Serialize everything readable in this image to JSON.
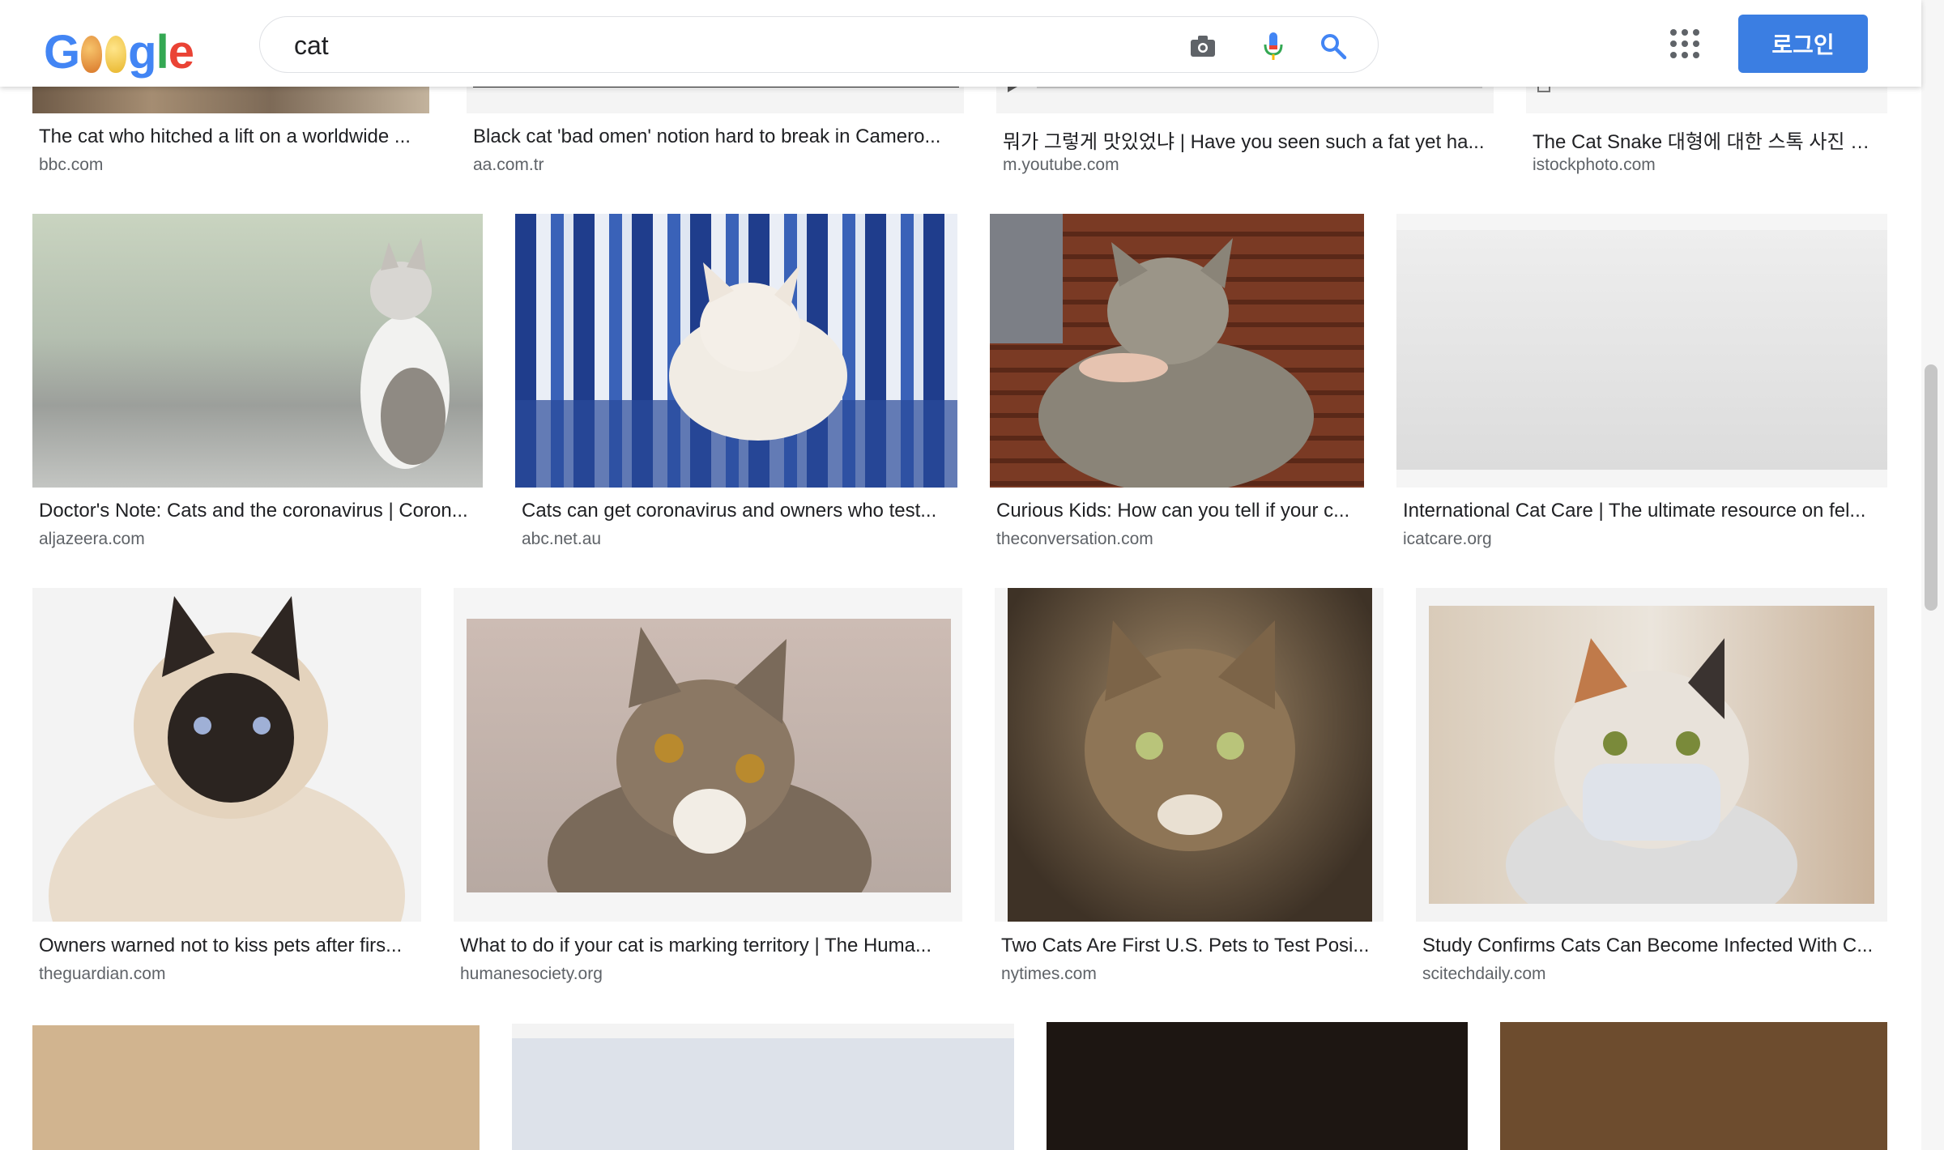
{
  "header": {
    "logo_letters": [
      "G",
      "o",
      "o",
      "g",
      "l",
      "e"
    ],
    "search_value": "cat",
    "login_label": "로그인"
  },
  "results": [
    {
      "title": "The cat who hitched a lift on a worldwide ...",
      "domain": "bbc.com"
    },
    {
      "title": "Black cat 'bad omen' notion hard to break in Camero...",
      "domain": "aa.com.tr"
    },
    {
      "title": "뭐가 그렇게 맛있었냐 | Have you seen such a fat yet ha...",
      "domain": "m.youtube.com"
    },
    {
      "title": "The Cat Snake 대형에 대한 스톡 사진 및 ...",
      "domain": "istockphoto.com"
    },
    {
      "title": "Doctor's Note: Cats and the coronavirus | Coron...",
      "domain": "aljazeera.com"
    },
    {
      "title": "Cats can get coronavirus and owners who test...",
      "domain": "abc.net.au"
    },
    {
      "title": "Curious Kids: How can you tell if your c...",
      "domain": "theconversation.com"
    },
    {
      "title": "International Cat Care | The ultimate resource on fel...",
      "domain": "icatcare.org"
    },
    {
      "title": "Owners warned not to kiss pets after firs...",
      "domain": "theguardian.com"
    },
    {
      "title": "What to do if your cat is marking territory | The Huma...",
      "domain": "humanesociety.org"
    },
    {
      "title": "Two Cats Are First U.S. Pets to Test Posi...",
      "domain": "nytimes.com"
    },
    {
      "title": "Study Confirms Cats Can Become Infected With C...",
      "domain": "scitechdaily.com"
    }
  ],
  "colors": {
    "accent": "#3b7ee2",
    "logo": [
      "#4285f4",
      "#ea4335",
      "#fbbc05",
      "#4285f4",
      "#34a853",
      "#ea4335"
    ]
  }
}
